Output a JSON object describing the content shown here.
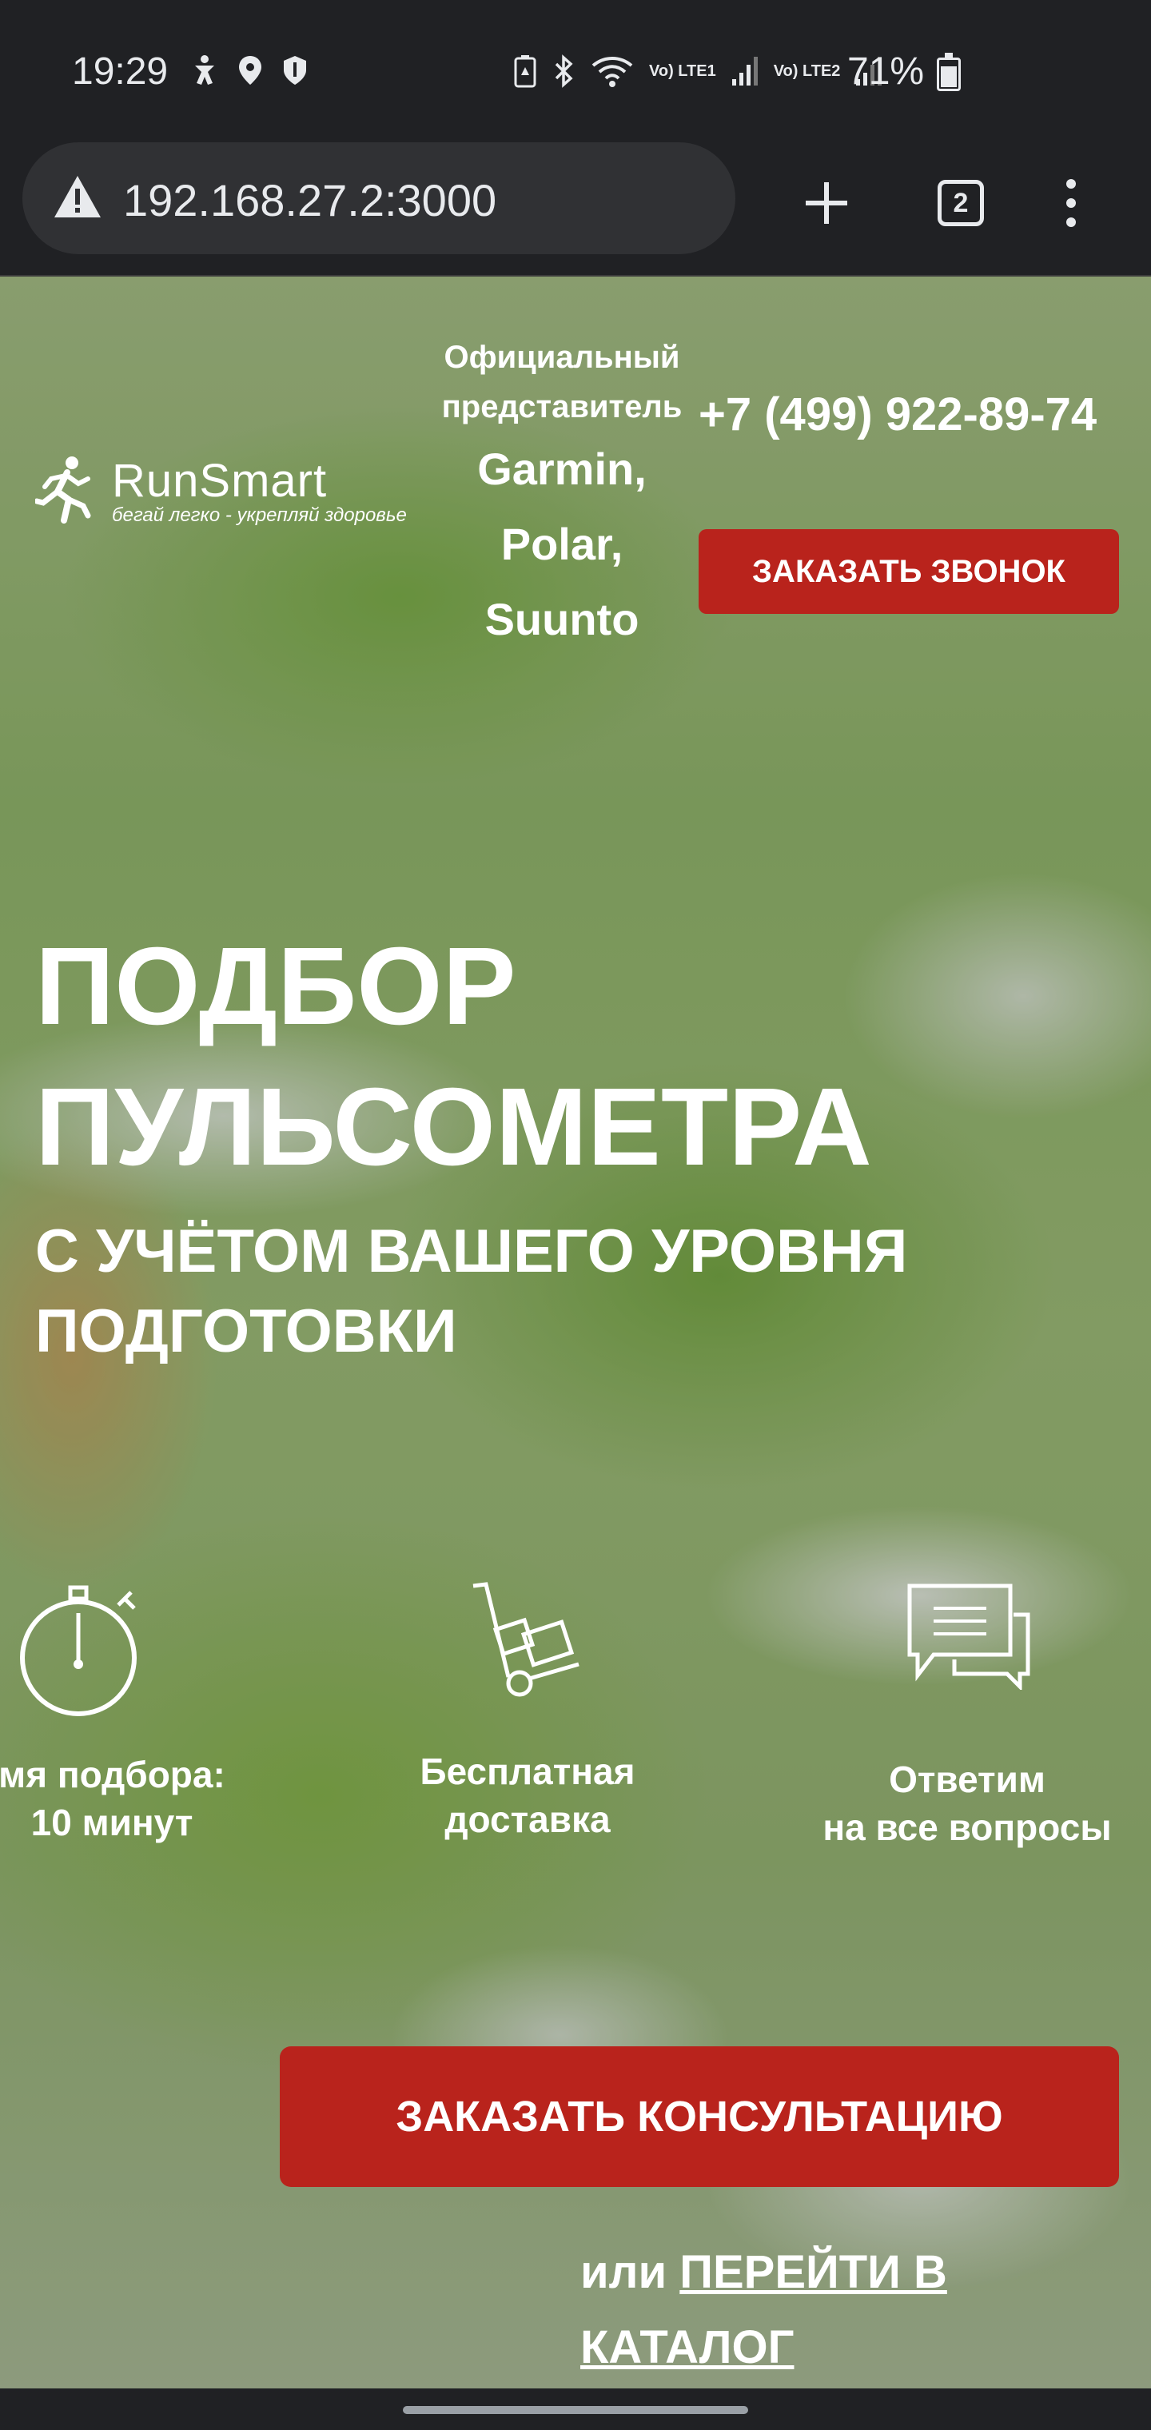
{
  "status": {
    "time": "19:29",
    "lte1": "Vo) LTE1",
    "lte2": "Vo) LTE2",
    "battery": "71%"
  },
  "browser": {
    "url": "192.168.27.2:3000",
    "tab_count": "2",
    "icons": [
      "warning-icon",
      "plus-icon",
      "tabs-icon",
      "more-icon"
    ]
  },
  "header": {
    "logo_name": "RunSmart",
    "logo_tagline": "бегай легко - укрепляй здоровье",
    "rep_line1": "Официальный",
    "rep_line2": "представитель",
    "brand1": "Garmin,",
    "brand2": "Polar,",
    "brand3": "Suunto",
    "phone": "+7 (499) 922-89-74",
    "callback_label": "ЗАКАЗАТЬ ЗВОНОК"
  },
  "hero": {
    "title_line1": "ПОДБОР",
    "title_line2": "ПУЛЬСОМЕТРА",
    "subtitle_line1": "С УЧЁТОМ ВАШЕГО УРОВНЯ",
    "subtitle_line2": "ПОДГОТОВКИ"
  },
  "features": [
    {
      "icon": "stopwatch-icon",
      "line1": "мя подбора:",
      "line2": "10 минут"
    },
    {
      "icon": "delivery-cart-icon",
      "line1": "Бесплатная",
      "line2": "доставка"
    },
    {
      "icon": "chat-bubbles-icon",
      "line1": "Ответим",
      "line2": "на все вопросы"
    }
  ],
  "cta": {
    "consult_label": "ЗАКАЗАТЬ КОНСУЛЬТАЦИЮ",
    "or_text": "или",
    "catalog_link": "ПЕРЕЙТИ В КАТАЛОГ"
  },
  "colors": {
    "accent_red": "#b9231c",
    "chrome_dark": "#202124",
    "omnibox": "#303134"
  }
}
